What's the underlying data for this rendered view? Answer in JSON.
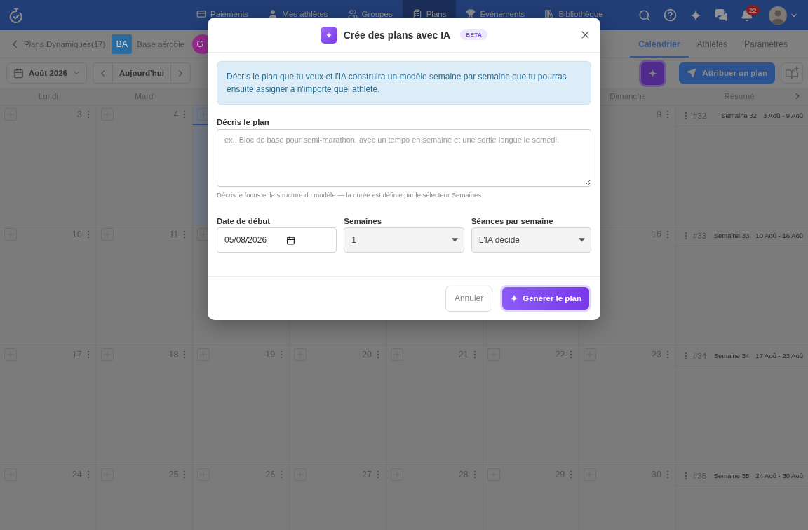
{
  "top_nav": {
    "items": [
      {
        "label": "Paiements",
        "selected": false
      },
      {
        "label": "Mes athlètes",
        "selected": false
      },
      {
        "label": "Groupes",
        "selected": false
      },
      {
        "label": "Plans",
        "selected": true
      },
      {
        "label": "Événements",
        "selected": false
      },
      {
        "label": "Bibliothèque",
        "selected": false
      }
    ],
    "notifications_badge": "22"
  },
  "plan_bar": {
    "back_label": "Plans Dynamiques(17)",
    "plans": [
      {
        "kind": "square",
        "initials": "BA",
        "name": "Base aérobie",
        "color": "#2a6c9f"
      },
      {
        "kind": "circle",
        "initials": "G",
        "color": "#962b8e"
      }
    ],
    "tabs": [
      {
        "label": "Calendrier",
        "selected": true
      },
      {
        "label": "Athlètes",
        "selected": false
      },
      {
        "label": "Paramètres",
        "selected": false
      }
    ]
  },
  "toolbar": {
    "month": "Août 2026",
    "today_button": "Aujourd'hui",
    "assign_button": "Attribuer un plan"
  },
  "calendar": {
    "day_headers": {
      "monday": "Lundi",
      "tuesday": "Mardi",
      "sunday": "Dimanche"
    },
    "summary_header": "Résumé",
    "weeks": [
      {
        "days": {
          "monday": {
            "number": "3",
            "add_button": true,
            "today": false
          },
          "tuesday": {
            "number": "4",
            "add_button": true,
            "today": false
          },
          "wednesday": {
            "add_button": true,
            "today": true
          },
          "sunday": {
            "number": "9",
            "today": false
          }
        },
        "summary": {
          "index": "#32",
          "title": "Semaine 32",
          "range": "3 Aoû - 9 Aoû"
        }
      },
      {
        "days": {
          "monday": {
            "number": "10",
            "add_button": true,
            "today": false
          },
          "tuesday": {
            "number": "11",
            "add_button": true,
            "today": false
          },
          "wednesday": {
            "add_button": true,
            "today": false
          },
          "thursday": {
            "today": false
          },
          "friday": {
            "today": false
          },
          "saturday": {
            "today": false
          },
          "sunday": {
            "number": "16",
            "today": false
          }
        },
        "summary": {
          "index": "#33",
          "title": "Semaine 33",
          "range": "10 Aoû - 16 Aoû"
        }
      },
      {
        "days": {
          "monday": {
            "number": "17",
            "add_button": true,
            "today": false
          },
          "tuesday": {
            "number": "18",
            "add_button": true,
            "today": false
          },
          "wednesday": {
            "number": "19",
            "add_button": true,
            "today": false
          },
          "thursday": {
            "number": "20",
            "add_button": true,
            "today": false
          },
          "friday": {
            "number": "21",
            "add_button": true,
            "today": false
          },
          "saturday": {
            "number": "22",
            "add_button": true,
            "today": false
          },
          "sunday": {
            "number": "23",
            "add_button": true,
            "today": false
          }
        },
        "summary": {
          "index": "#34",
          "title": "Semaine 34",
          "range": "17 Aoû - 23 Aoû"
        }
      },
      {
        "days": {
          "monday": {
            "number": "24",
            "add_button": true,
            "today": false
          },
          "tuesday": {
            "number": "25",
            "add_button": true,
            "today": false
          },
          "wednesday": {
            "number": "26",
            "add_button": true,
            "today": false
          },
          "thursday": {
            "number": "27",
            "add_button": true,
            "today": false
          },
          "friday": {
            "number": "28",
            "add_button": true,
            "today": false
          },
          "saturday": {
            "number": "29",
            "add_button": true,
            "today": false
          },
          "sunday": {
            "number": "30",
            "add_button": true,
            "today": false
          }
        },
        "summary": {
          "index": "#35",
          "title": "Semaine 35",
          "range": "24 Aoû - 30 Aoû"
        }
      }
    ]
  },
  "modal": {
    "title": "Crée des plans avec IA",
    "badge": "BETA",
    "info": "Décris le plan que tu veux et l'IA construira un modèle semaine par semaine que tu pourras ensuite assigner à n'importe quel athlète.",
    "description": {
      "label": "Décris le plan",
      "placeholder": "ex., Bloc de base pour semi-marathon, avec un tempo en semaine et une sortie longue le samedi.",
      "hint": "Décris le focus et la structure du modèle — la durée est définie par le sélecteur Semaines."
    },
    "fields": [
      {
        "kind": "date",
        "label": "Date de début",
        "value": "05/08/2026"
      },
      {
        "kind": "select",
        "label": "Semaines",
        "value": "1"
      },
      {
        "kind": "select",
        "label": "Séances par semaine",
        "value": "L'IA décide"
      }
    ],
    "buttons": [
      {
        "kind": "secondary",
        "label": "Annuler"
      },
      {
        "kind": "primary",
        "label": "Générer le plan"
      }
    ]
  }
}
